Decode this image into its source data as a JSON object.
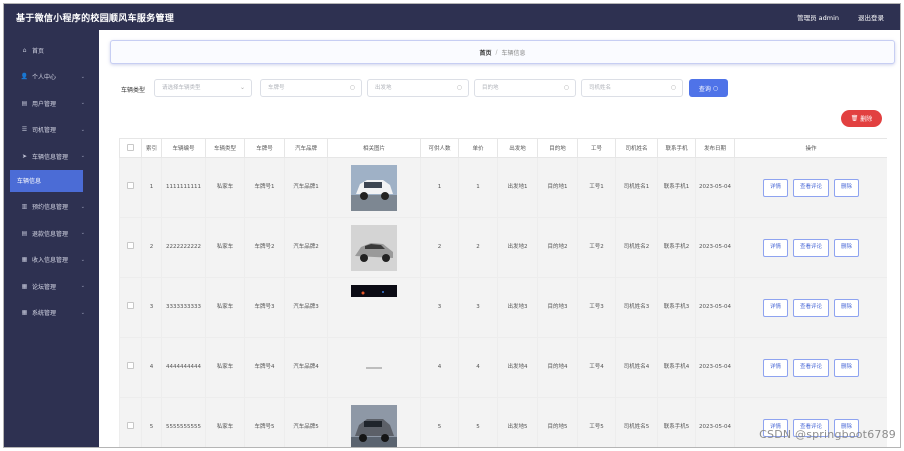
{
  "header": {
    "title": "基于微信小程序的校园顺风车服务管理",
    "admin": "管理员 admin",
    "logout": "退出登录"
  },
  "sidebar": {
    "items": [
      {
        "label": "首页",
        "icon": "⌂",
        "chev": false
      },
      {
        "label": "个人中心",
        "icon": "👤",
        "chev": true
      },
      {
        "label": "用户管理",
        "icon": "▤",
        "chev": true
      },
      {
        "label": "司机管理",
        "icon": "☰",
        "chev": true
      },
      {
        "label": "车辆信息管理",
        "icon": "➤",
        "chev": true
      }
    ],
    "active_sub": "车辆信息",
    "items2": [
      {
        "label": "预约信息管理",
        "icon": "▥",
        "chev": true
      },
      {
        "label": "退款信息管理",
        "icon": "▤",
        "chev": true
      },
      {
        "label": "收入信息管理",
        "icon": "▦",
        "chev": true
      },
      {
        "label": "论坛管理",
        "icon": "▦",
        "chev": true
      },
      {
        "label": "系统管理",
        "icon": "▦",
        "chev": true
      }
    ]
  },
  "breadcrumb": {
    "home": "首页",
    "sep": "/",
    "current": "车辆信息"
  },
  "filters": {
    "label": "车辆类型",
    "type_placeholder": "请选择车辆类型",
    "plate_placeholder": "车牌号",
    "origin_placeholder": "出发地",
    "dest_placeholder": "目的地",
    "driver_placeholder": "司机姓名",
    "query": "查询",
    "delete": "删除"
  },
  "table": {
    "headers": [
      "索引",
      "车辆编号",
      "车辆类型",
      "车牌号",
      "汽车品牌",
      "相关图片",
      "可供人数",
      "单价",
      "出发地",
      "目的地",
      "工号",
      "司机姓名",
      "联系手机",
      "发布日期",
      "操作"
    ],
    "ops": [
      "详情",
      "查看评论",
      "删除"
    ],
    "rows": [
      {
        "index": "1",
        "code": "1111111111",
        "type": "私家车",
        "plate": "车牌号1",
        "brand": "汽车品牌1",
        "image": "car-photo-white-suv",
        "seats": "1",
        "price": "1",
        "from": "出发地1",
        "to": "目的地1",
        "job": "工号1",
        "driver": "司机姓名1",
        "phone": "联系手机1",
        "date": "2023-05-04"
      },
      {
        "index": "2",
        "code": "2222222222",
        "type": "私家车",
        "plate": "车牌号2",
        "brand": "汽车品牌2",
        "image": "car-photo-silver-coupe",
        "seats": "2",
        "price": "2",
        "from": "出发地2",
        "to": "目的地2",
        "job": "工号2",
        "driver": "司机姓名2",
        "phone": "联系手机2",
        "date": "2023-05-04"
      },
      {
        "index": "3",
        "code": "3333333333",
        "type": "私家车",
        "plate": "车牌号3",
        "brand": "汽车品牌3",
        "image": "car-photo-dark-night",
        "seats": "3",
        "price": "3",
        "from": "出发地3",
        "to": "目的地3",
        "job": "工号3",
        "driver": "司机姓名3",
        "phone": "联系手机3",
        "date": "2023-05-04"
      },
      {
        "index": "4",
        "code": "4444444444",
        "type": "私家车",
        "plate": "车牌号4",
        "brand": "汽车品牌4",
        "image": "car-photo-faint",
        "seats": "4",
        "price": "4",
        "from": "出发地4",
        "to": "目的地4",
        "job": "工号4",
        "driver": "司机姓名4",
        "phone": "联系手机4",
        "date": "2023-05-04"
      },
      {
        "index": "5",
        "code": "5555555555",
        "type": "私家车",
        "plate": "车牌号5",
        "brand": "汽车品牌5",
        "image": "car-photo-grey-suv",
        "seats": "5",
        "price": "5",
        "from": "出发地5",
        "to": "目的地5",
        "job": "工号5",
        "driver": "司机姓名5",
        "phone": "联系手机5",
        "date": "2023-05-04"
      }
    ]
  },
  "watermark": "CSDN @springboot6789"
}
